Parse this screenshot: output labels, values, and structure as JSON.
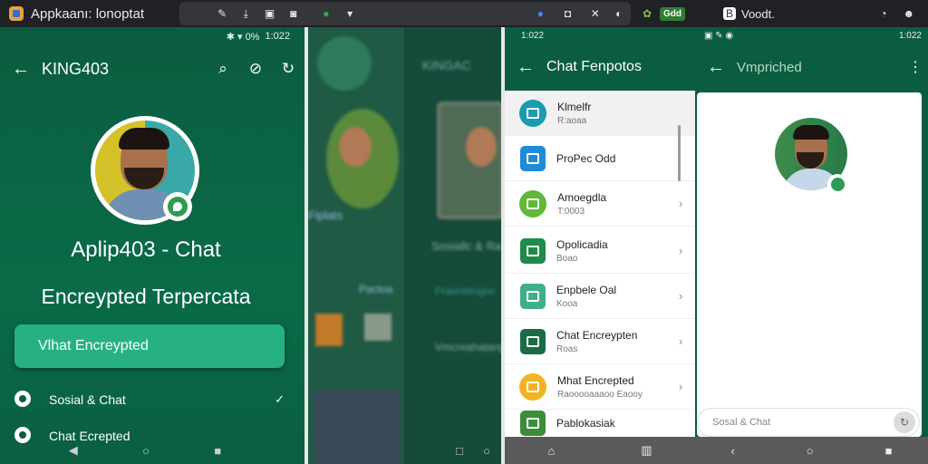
{
  "topbar": {
    "app_title": "Appkaanı: lonoptat",
    "right_badge": "Gdd",
    "right_name": "Voodt."
  },
  "panel1": {
    "status": {
      "icons": "✱ ▾ 0%",
      "time": "1:022"
    },
    "header_name": "KING403",
    "title": "Aplip403 - Chat",
    "subtitle": "Encreypted Terpercata",
    "button_label": "Vlhat Encreypted",
    "rows": [
      {
        "label": "Sosial & Chat"
      },
      {
        "label": "Chat Ecrepted"
      }
    ]
  },
  "panel2": {
    "label_a": "Fiplats",
    "label_b": "Pactoa"
  },
  "panel3": {
    "header_name": "KINGAC",
    "label_a": "Sosiallc & Ra",
    "label_b": "Fraenelogoc",
    "label_c": "Vmcreahatanjv"
  },
  "panel4": {
    "status": {
      "time": "1:022"
    },
    "title": "Chat Fenpotos",
    "items": [
      {
        "title": "Klmelfr",
        "sub": "R:aoaa",
        "color": "#1a9bb0"
      },
      {
        "title": "ProPec Odd",
        "sub": "",
        "color": "#1e8bd6"
      },
      {
        "title": "Amoegdla",
        "sub": "T:0003",
        "color": "#5fb93a"
      },
      {
        "title": "Opolicadia",
        "sub": "Boao",
        "color": "#1f8a4a"
      },
      {
        "title": "Enpbele Oal",
        "sub": "Kooa",
        "color": "#3fae8a"
      },
      {
        "title": "Chat Encreypten",
        "sub": "Roas",
        "color": "#1b6b45"
      },
      {
        "title": "Mhat Encrepted",
        "sub": "Raooooaaaoo Eaooy",
        "color": "#f0b323"
      },
      {
        "title": "Pablokasiak",
        "sub": "",
        "color": "#3c8d3a"
      }
    ]
  },
  "panel5": {
    "status": {
      "time": "1:022"
    },
    "title": "Vmpriched",
    "input_placeholder": "Sosal & Chat"
  }
}
